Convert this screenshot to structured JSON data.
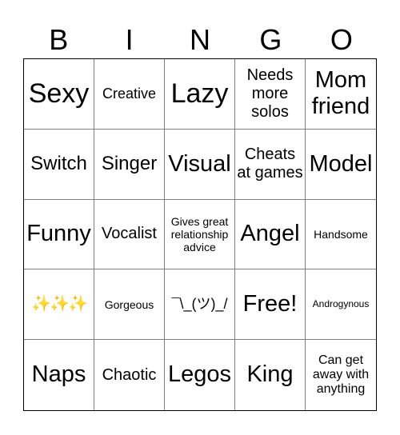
{
  "header": [
    "B",
    "I",
    "N",
    "G",
    "O"
  ],
  "cells": [
    [
      "Sexy",
      "Creative",
      "Lazy",
      "Needs more solos",
      "Mom friend"
    ],
    [
      "Switch",
      "Singer",
      "Visual",
      "Cheats at games",
      "Model"
    ],
    [
      "Funny",
      "Vocalist",
      "Gives great relationship advice",
      "Angel",
      "Handsome"
    ],
    [
      "✨✨✨",
      "Gorgeous",
      "¯\\_(ツ)_/",
      "Free!",
      "Androgynous"
    ],
    [
      "Naps",
      "Chaotic",
      "Legos",
      "King",
      "Can get away with anything"
    ]
  ]
}
